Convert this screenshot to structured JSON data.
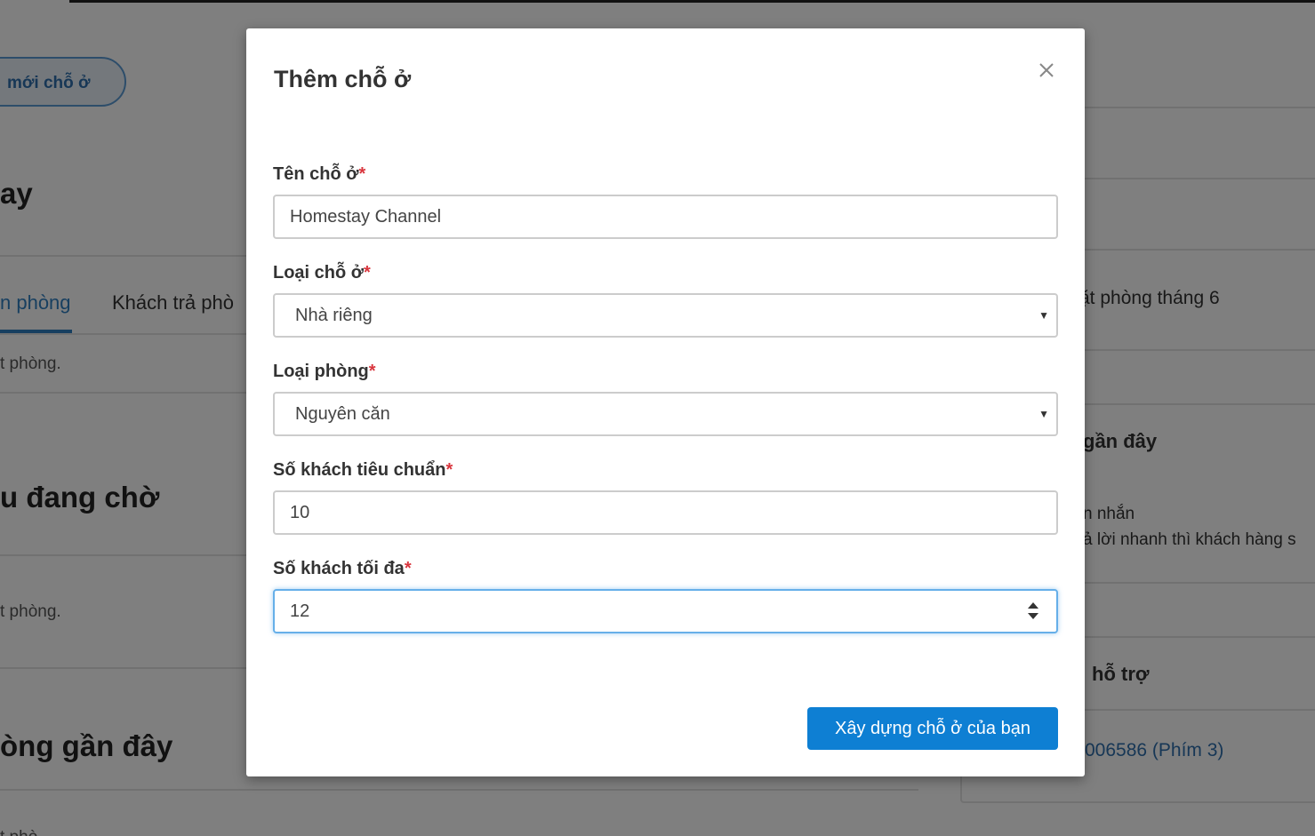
{
  "background": {
    "add_button_label": "mới chỗ ở",
    "heading_1": "ay",
    "tabs": [
      {
        "label": "n phòng",
        "active": true
      },
      {
        "label": "Khách trả phò",
        "active": false
      }
    ],
    "text_1": "t phòng.",
    "heading_2": "u đang chờ",
    "text_2": "t phòng.",
    "heading_3": "òng gần đây",
    "text_3": "t phò",
    "right_panel": {
      "line_1": "ặt phòng tháng 6",
      "heading_1": "gần đây",
      "msg_line_1": "n nhắn",
      "msg_line_2": "ả lời nhanh thì khách hàng s",
      "heading_2": "hỗ trợ",
      "phone": "006586 (Phím 3)"
    }
  },
  "modal": {
    "title": "Thêm chỗ ở",
    "close_icon": "close-icon",
    "required_mark": "*",
    "fields": [
      {
        "label": "Tên chỗ ở",
        "value": "Homestay Channel",
        "type": "text"
      },
      {
        "label": "Loại chỗ ở",
        "value": "Nhà riêng",
        "type": "select"
      },
      {
        "label": "Loại phòng",
        "value": "Nguyên căn",
        "type": "select"
      },
      {
        "label": "Số khách tiêu chuẩn",
        "value": "10",
        "type": "number"
      },
      {
        "label": "Số khách tối đa",
        "value": "12",
        "type": "number",
        "focused": true
      }
    ],
    "submit_label": "Xây dựng chỗ ở của bạn"
  },
  "colors": {
    "primary": "#0e7fd3",
    "required": "#d9363e",
    "focus": "#66afe9",
    "link": "#2f6fad"
  }
}
